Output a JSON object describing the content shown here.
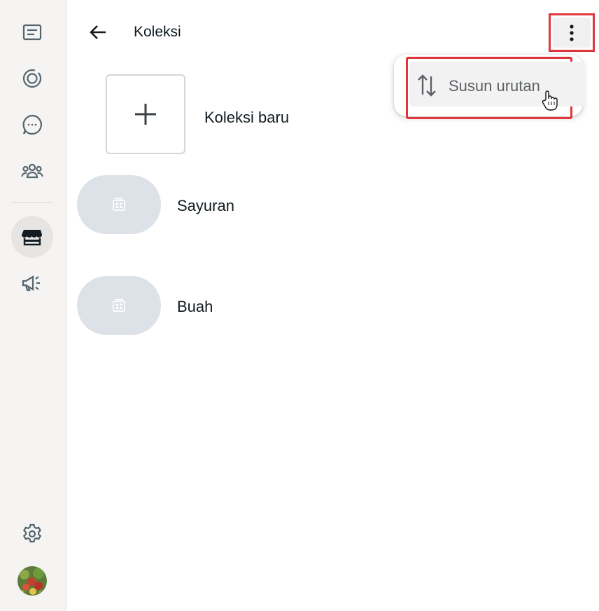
{
  "header": {
    "title": "Koleksi",
    "back_icon": "arrow-left-icon",
    "menu_icon": "more-vertical-icon"
  },
  "dropdown": {
    "items": [
      {
        "label": "Susun urutan",
        "icon": "sort-arrows-icon"
      }
    ]
  },
  "new_collection": {
    "label": "Koleksi baru",
    "icon": "plus-icon"
  },
  "collections": [
    {
      "label": "Sayuran",
      "icon": "catalog-icon"
    },
    {
      "label": "Buah",
      "icon": "catalog-icon"
    }
  ],
  "sidebar": {
    "items": [
      {
        "name": "chats",
        "icon": "chat-list-icon"
      },
      {
        "name": "status",
        "icon": "status-icon"
      },
      {
        "name": "channels",
        "icon": "channel-icon"
      },
      {
        "name": "communities",
        "icon": "community-icon"
      },
      {
        "name": "catalog",
        "icon": "storefront-icon",
        "active": true
      },
      {
        "name": "ads",
        "icon": "megaphone-icon"
      }
    ],
    "settings_icon": "gear-icon"
  },
  "colors": {
    "highlight": "#e0353b",
    "sidebar_bg": "#f5f4f2",
    "thumb_bg": "#dde1e8"
  }
}
